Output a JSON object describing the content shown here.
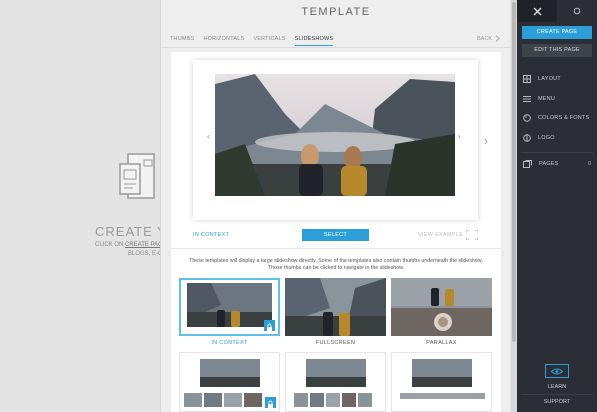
{
  "background": {
    "title": "CREATE Y",
    "sub_prefix": "CLICK ON ",
    "sub_link": "CREATE PAGE",
    "sub_line2": "BLOGS, E-C"
  },
  "modal": {
    "title": "TEMPLATE",
    "tabs": [
      "THUMBS",
      "HORIZONTALS",
      "VERTICALS",
      "SLIDESHOWS"
    ],
    "active_tab": "SLIDESHOWS",
    "back_label": "BACK",
    "in_context": "IN CONTEXT",
    "select_label": "SELECT",
    "view_example": "VIEW EXAMPLE",
    "description": "These templates will display a large slideshow directly. Some of the templates also contain thumbs underneath the slideshow. Those thumbs can be clicked to navigate in the slideshow.",
    "thumbs": [
      {
        "label": "IN CONTEXT"
      },
      {
        "label": "FULLSCREEN"
      },
      {
        "label": "PARALLAX"
      }
    ]
  },
  "sidebar": {
    "create_label": "CREATE PAGE",
    "edit_label": "EDIT THIS PAGE",
    "items": [
      {
        "label": "LAYOUT",
        "icon": "layout-icon"
      },
      {
        "label": "MENU",
        "icon": "menu-icon"
      },
      {
        "label": "COLORS & FONTS",
        "icon": "palette-icon"
      },
      {
        "label": "LOGO",
        "icon": "logo-icon"
      },
      {
        "label": "PAGES",
        "icon": "pages-icon"
      }
    ],
    "pages_count": "0",
    "learn_label": "LEARN",
    "support_label": "SUPPORT"
  },
  "colors": {
    "accent": "#2c9fd8",
    "sidebar_bg": "#2b2e34"
  }
}
